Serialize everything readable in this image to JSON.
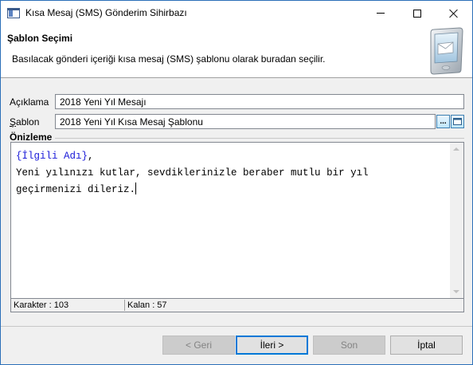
{
  "window": {
    "title": "Kısa Mesaj (SMS) Gönderim Sihirbazı"
  },
  "header": {
    "title": "Şablon Seçimi",
    "description": "Basılacak gönderi içeriği kısa mesaj (SMS) şablonu olarak buradan seçilir."
  },
  "form": {
    "aciklama_label": "Açıklama",
    "aciklama_value": "2018 Yeni Yıl Mesajı",
    "sablon_label_first": "Ş",
    "sablon_label_rest": "ablon",
    "sablon_value": "2018 Yeni Yıl Kısa Mesaj Şablonu",
    "browse_label": "..."
  },
  "preview": {
    "group_label": "Önizleme",
    "line1_tag": "{İlgili Adı}",
    "line1_rest": ",",
    "line2": "Yeni yılınızı kutlar, sevdiklerinizle beraber mutlu bir yıl",
    "line3": "geçirmenizi dileriz."
  },
  "status": {
    "karakter": "Karakter : 103",
    "kalan": "Kalan : 57"
  },
  "buttons": {
    "back": "< Geri",
    "next": "İleri >",
    "finish": "Son",
    "cancel": "İptal"
  },
  "colors": {
    "accent": "#0078d7",
    "tag_color": "#1a1ad8"
  }
}
